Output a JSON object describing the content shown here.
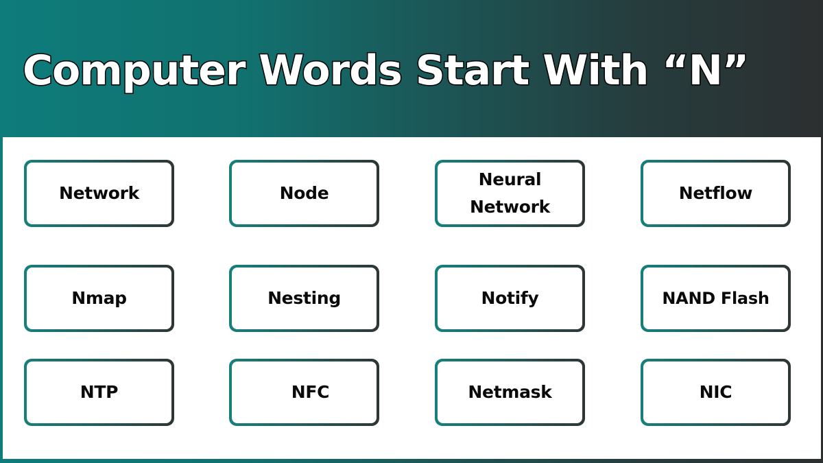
{
  "header": {
    "title": "Computer Words Start With “N”"
  },
  "colors": {
    "teal": "#0e7c7b",
    "dark": "#2c2f30",
    "panel": "#ffffff",
    "text": "#0a0a0a"
  },
  "words": [
    [
      "Network",
      "Node",
      "Neural Network",
      "Netflow"
    ],
    [
      "Nmap",
      "Nesting",
      "Notify",
      "NAND Flash"
    ],
    [
      "NTP",
      "NFC",
      "Netmask",
      "NIC"
    ]
  ]
}
